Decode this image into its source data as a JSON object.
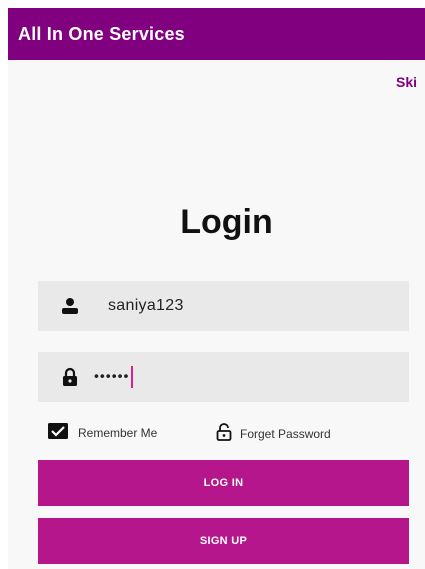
{
  "app_bar": {
    "title": "All In One Services",
    "color": "#800080"
  },
  "skip_label": "Ski",
  "login": {
    "title": "Login",
    "username": {
      "value": "saniya123",
      "icon": "person-icon"
    },
    "password": {
      "value": "••••••",
      "icon": "lock-icon"
    },
    "remember_label": "Remember Me",
    "remember_checked": true,
    "forget_label": "Forget Password",
    "login_button": "LOG IN",
    "signup_button": "SIGN UP",
    "button_color": "#b5168b"
  }
}
